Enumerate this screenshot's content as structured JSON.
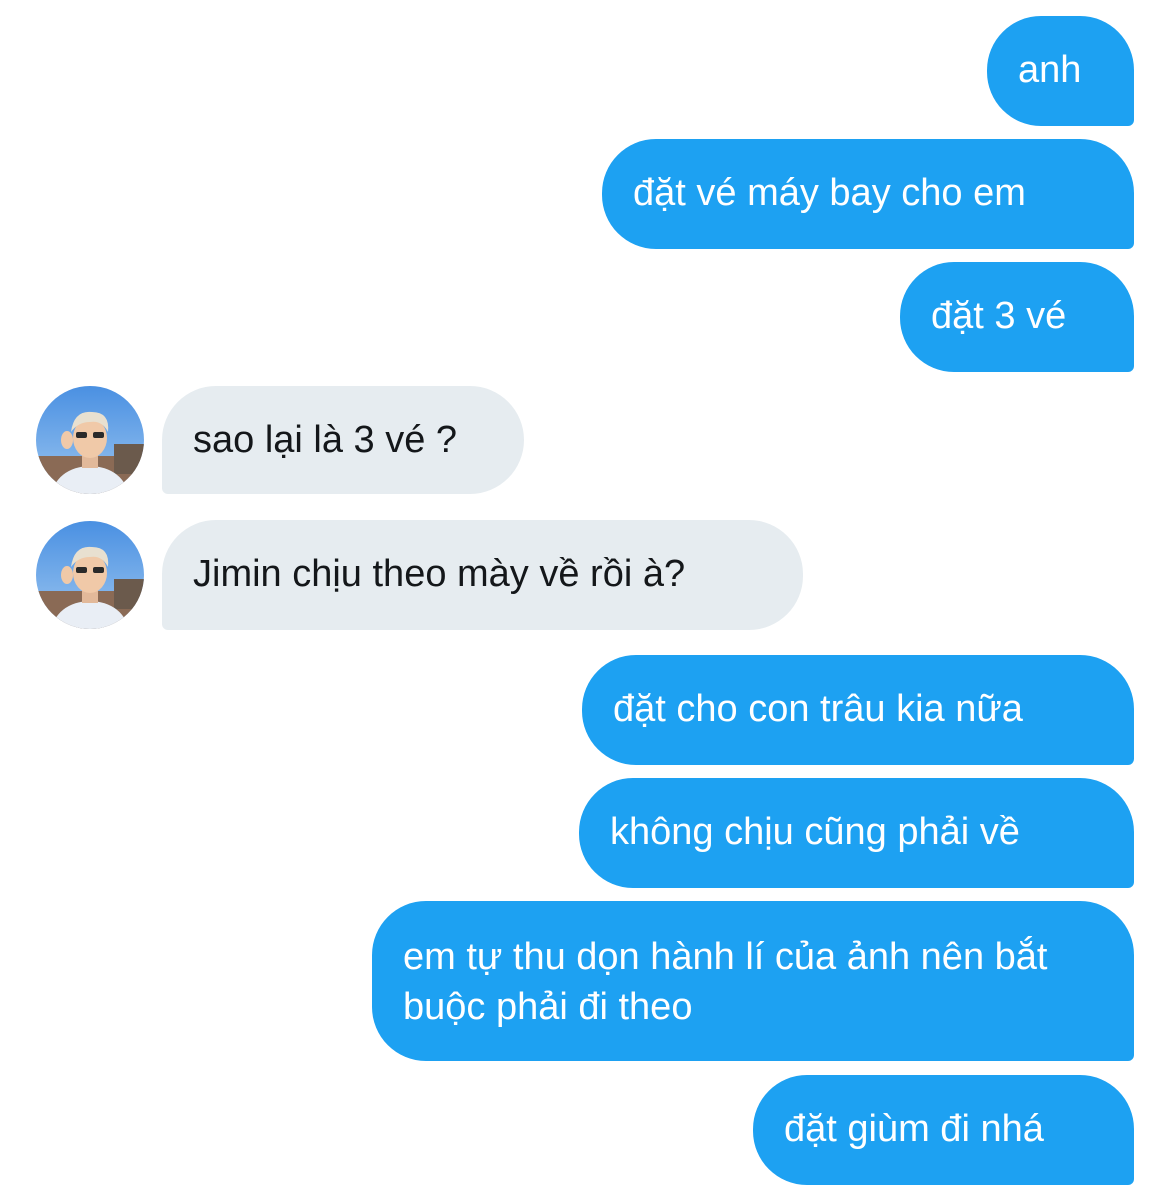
{
  "messages": [
    {
      "sender": "me",
      "text": "anh"
    },
    {
      "sender": "me",
      "text": "đặt vé máy bay cho em"
    },
    {
      "sender": "me",
      "text": "đặt 3 vé"
    },
    {
      "sender": "other",
      "text": "sao lại là 3 vé ?"
    },
    {
      "sender": "other",
      "text": "Jimin chịu theo mày về rồi à?"
    },
    {
      "sender": "me",
      "text": "đặt cho con trâu kia nữa"
    },
    {
      "sender": "me",
      "text": "không chịu cũng phải về"
    },
    {
      "sender": "me",
      "text": "em tự thu dọn hành lí của ảnh nên bắt buộc phải đi theo"
    },
    {
      "sender": "me",
      "text": "đặt giùm đi nhá"
    }
  ],
  "colors": {
    "outgoing_bubble": "#1da1f2",
    "incoming_bubble": "#e6ecf0",
    "incoming_text": "#14171a",
    "background": "#ffffff"
  },
  "icons": {
    "avatar": "contact-avatar-photo"
  }
}
